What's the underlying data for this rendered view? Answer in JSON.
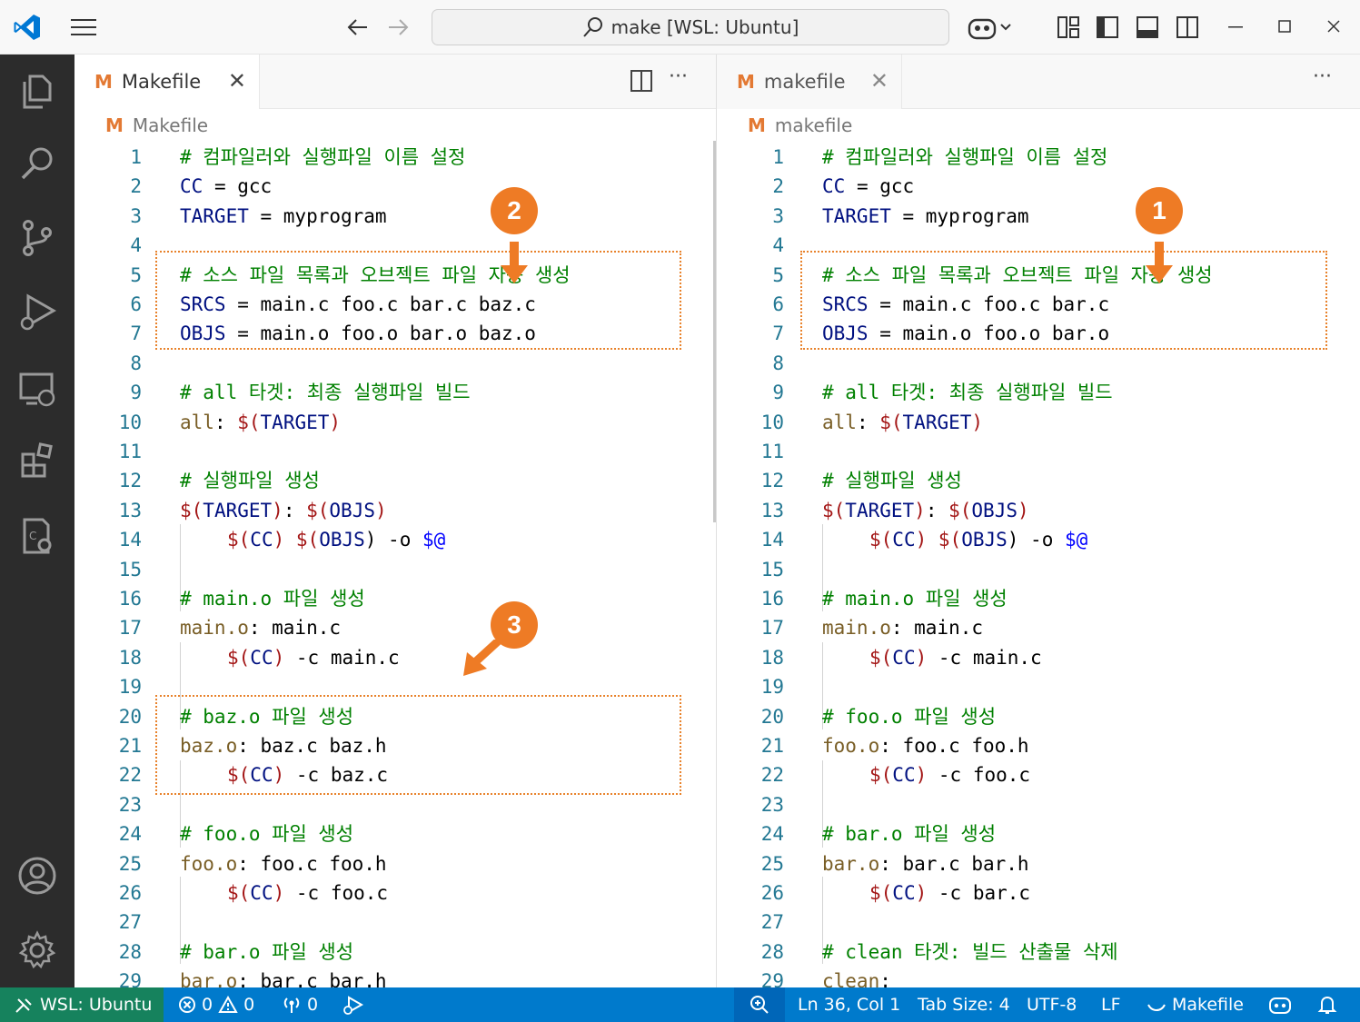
{
  "titlebar": {
    "search_text": "make [WSL: Ubuntu]"
  },
  "left_editor": {
    "tab_label": "Makefile",
    "breadcrumb": "Makefile",
    "badge_top": "2",
    "badge_bottom": "3",
    "lines": [
      {
        "n": "1"
      },
      {
        "n": "2"
      },
      {
        "n": "3"
      },
      {
        "n": "4"
      },
      {
        "n": "5"
      },
      {
        "n": "6"
      },
      {
        "n": "7"
      },
      {
        "n": "8"
      },
      {
        "n": "9"
      },
      {
        "n": "10"
      },
      {
        "n": "11"
      },
      {
        "n": "12"
      },
      {
        "n": "13"
      },
      {
        "n": "14"
      },
      {
        "n": "15"
      },
      {
        "n": "16"
      },
      {
        "n": "17"
      },
      {
        "n": "18"
      },
      {
        "n": "19"
      },
      {
        "n": "20"
      },
      {
        "n": "21"
      },
      {
        "n": "22"
      },
      {
        "n": "23"
      },
      {
        "n": "24"
      },
      {
        "n": "25"
      },
      {
        "n": "26"
      },
      {
        "n": "27"
      },
      {
        "n": "28"
      },
      {
        "n": "29"
      }
    ],
    "code": {
      "l1": "# 컴파일러와 실행파일 이름 설정",
      "l2a": "CC",
      "l2b": " = gcc",
      "l3a": "TARGET",
      "l3b": " = myprogram",
      "l5": "# 소스 파일 목록과 오브젝트 파일 자동 생성",
      "l6a": "SRCS",
      "l6b": " = main.c foo.c bar.c baz.c",
      "l7a": "OBJS",
      "l7b": " = main.o foo.o bar.o baz.o",
      "l9": "# all 타겟: 최종 실행파일 빌드",
      "l10a": "all",
      "l10b": ": ",
      "l10c": "$(",
      "l10d": "TARGET",
      "l10e": ")",
      "l12": "# 실행파일 생성",
      "l13a": "$(",
      "l13b": "TARGET",
      "l13c": ")",
      "l13d": ": ",
      "l13e": "$(",
      "l13f": "OBJS",
      "l13g": ")",
      "l14a": "$(",
      "l14b": "CC",
      "l14c": ") ",
      "l14d": "$(",
      "l14e": "OBJS",
      "l14f": ") -o ",
      "l14g": "$@",
      "l16": "# main.o 파일 생성",
      "l17a": "main.o",
      "l17b": ": main.c",
      "l18a": "$(",
      "l18b": "CC",
      "l18c": ")",
      "l18d": " -c main.c",
      "l20": "# baz.o 파일 생성",
      "l21a": "baz.o",
      "l21b": ": baz.c baz.h",
      "l22a": "$(",
      "l22b": "CC",
      "l22c": ")",
      "l22d": " -c baz.c",
      "l24": "# foo.o 파일 생성",
      "l25a": "foo.o",
      "l25b": ": foo.c foo.h",
      "l26a": "$(",
      "l26b": "CC",
      "l26c": ")",
      "l26d": " -c foo.c",
      "l28": "# bar.o 파일 생성",
      "l29a": "bar.o",
      "l29b": ": bar.c bar.h"
    }
  },
  "right_editor": {
    "tab_label": "makefile",
    "breadcrumb": "makefile",
    "badge_top": "1",
    "code": {
      "l1": "# 컴파일러와 실행파일 이름 설정",
      "l2a": "CC",
      "l2b": " = gcc",
      "l3a": "TARGET",
      "l3b": " = myprogram",
      "l5": "# 소스 파일 목록과 오브젝트 파일 자동 생성",
      "l6a": "SRCS",
      "l6b": " = main.c foo.c bar.c",
      "l7a": "OBJS",
      "l7b": " = main.o foo.o bar.o",
      "l9": "# all 타겟: 최종 실행파일 빌드",
      "l10a": "all",
      "l10b": ": ",
      "l10c": "$(",
      "l10d": "TARGET",
      "l10e": ")",
      "l12": "# 실행파일 생성",
      "l13a": "$(",
      "l13b": "TARGET",
      "l13c": ")",
      "l13d": ": ",
      "l13e": "$(",
      "l13f": "OBJS",
      "l13g": ")",
      "l14a": "$(",
      "l14b": "CC",
      "l14c": ") ",
      "l14d": "$(",
      "l14e": "OBJS",
      "l14f": ") -o ",
      "l14g": "$@",
      "l16": "# main.o 파일 생성",
      "l17a": "main.o",
      "l17b": ": main.c",
      "l18a": "$(",
      "l18b": "CC",
      "l18c": ")",
      "l18d": " -c main.c",
      "l20": "# foo.o 파일 생성",
      "l21a": "foo.o",
      "l21b": ": foo.c foo.h",
      "l22a": "$(",
      "l22b": "CC",
      "l22c": ")",
      "l22d": " -c foo.c",
      "l24": "# bar.o 파일 생성",
      "l25a": "bar.o",
      "l25b": ": bar.c bar.h",
      "l26a": "$(",
      "l26b": "CC",
      "l26c": ")",
      "l26d": " -c bar.c",
      "l28": "# clean 타겟: 빌드 산출물 삭제",
      "l29a": "clean",
      "l29b": ":"
    }
  },
  "statusbar": {
    "remote": "WSL: Ubuntu",
    "errors": "0",
    "warnings": "0",
    "ports": "0",
    "cursor": "Ln 36, Col 1",
    "tab_size": "Tab Size: 4",
    "encoding": "UTF-8",
    "eol": "LF",
    "language": "Makefile"
  },
  "colors": {
    "accent_blue": "#007acc",
    "remote_green": "#16825d",
    "badge_orange": "#ee7b25",
    "activity_bg": "#2c2c2c"
  }
}
